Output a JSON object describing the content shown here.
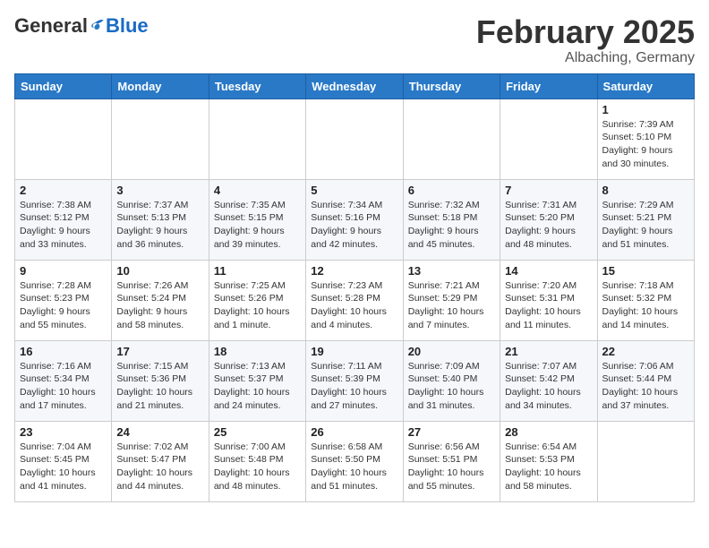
{
  "header": {
    "logo_general": "General",
    "logo_blue": "Blue",
    "month": "February 2025",
    "location": "Albaching, Germany"
  },
  "weekdays": [
    "Sunday",
    "Monday",
    "Tuesday",
    "Wednesday",
    "Thursday",
    "Friday",
    "Saturday"
  ],
  "weeks": [
    [
      {
        "day": "",
        "info": ""
      },
      {
        "day": "",
        "info": ""
      },
      {
        "day": "",
        "info": ""
      },
      {
        "day": "",
        "info": ""
      },
      {
        "day": "",
        "info": ""
      },
      {
        "day": "",
        "info": ""
      },
      {
        "day": "1",
        "info": "Sunrise: 7:39 AM\nSunset: 5:10 PM\nDaylight: 9 hours and 30 minutes."
      }
    ],
    [
      {
        "day": "2",
        "info": "Sunrise: 7:38 AM\nSunset: 5:12 PM\nDaylight: 9 hours and 33 minutes."
      },
      {
        "day": "3",
        "info": "Sunrise: 7:37 AM\nSunset: 5:13 PM\nDaylight: 9 hours and 36 minutes."
      },
      {
        "day": "4",
        "info": "Sunrise: 7:35 AM\nSunset: 5:15 PM\nDaylight: 9 hours and 39 minutes."
      },
      {
        "day": "5",
        "info": "Sunrise: 7:34 AM\nSunset: 5:16 PM\nDaylight: 9 hours and 42 minutes."
      },
      {
        "day": "6",
        "info": "Sunrise: 7:32 AM\nSunset: 5:18 PM\nDaylight: 9 hours and 45 minutes."
      },
      {
        "day": "7",
        "info": "Sunrise: 7:31 AM\nSunset: 5:20 PM\nDaylight: 9 hours and 48 minutes."
      },
      {
        "day": "8",
        "info": "Sunrise: 7:29 AM\nSunset: 5:21 PM\nDaylight: 9 hours and 51 minutes."
      }
    ],
    [
      {
        "day": "9",
        "info": "Sunrise: 7:28 AM\nSunset: 5:23 PM\nDaylight: 9 hours and 55 minutes."
      },
      {
        "day": "10",
        "info": "Sunrise: 7:26 AM\nSunset: 5:24 PM\nDaylight: 9 hours and 58 minutes."
      },
      {
        "day": "11",
        "info": "Sunrise: 7:25 AM\nSunset: 5:26 PM\nDaylight: 10 hours and 1 minute."
      },
      {
        "day": "12",
        "info": "Sunrise: 7:23 AM\nSunset: 5:28 PM\nDaylight: 10 hours and 4 minutes."
      },
      {
        "day": "13",
        "info": "Sunrise: 7:21 AM\nSunset: 5:29 PM\nDaylight: 10 hours and 7 minutes."
      },
      {
        "day": "14",
        "info": "Sunrise: 7:20 AM\nSunset: 5:31 PM\nDaylight: 10 hours and 11 minutes."
      },
      {
        "day": "15",
        "info": "Sunrise: 7:18 AM\nSunset: 5:32 PM\nDaylight: 10 hours and 14 minutes."
      }
    ],
    [
      {
        "day": "16",
        "info": "Sunrise: 7:16 AM\nSunset: 5:34 PM\nDaylight: 10 hours and 17 minutes."
      },
      {
        "day": "17",
        "info": "Sunrise: 7:15 AM\nSunset: 5:36 PM\nDaylight: 10 hours and 21 minutes."
      },
      {
        "day": "18",
        "info": "Sunrise: 7:13 AM\nSunset: 5:37 PM\nDaylight: 10 hours and 24 minutes."
      },
      {
        "day": "19",
        "info": "Sunrise: 7:11 AM\nSunset: 5:39 PM\nDaylight: 10 hours and 27 minutes."
      },
      {
        "day": "20",
        "info": "Sunrise: 7:09 AM\nSunset: 5:40 PM\nDaylight: 10 hours and 31 minutes."
      },
      {
        "day": "21",
        "info": "Sunrise: 7:07 AM\nSunset: 5:42 PM\nDaylight: 10 hours and 34 minutes."
      },
      {
        "day": "22",
        "info": "Sunrise: 7:06 AM\nSunset: 5:44 PM\nDaylight: 10 hours and 37 minutes."
      }
    ],
    [
      {
        "day": "23",
        "info": "Sunrise: 7:04 AM\nSunset: 5:45 PM\nDaylight: 10 hours and 41 minutes."
      },
      {
        "day": "24",
        "info": "Sunrise: 7:02 AM\nSunset: 5:47 PM\nDaylight: 10 hours and 44 minutes."
      },
      {
        "day": "25",
        "info": "Sunrise: 7:00 AM\nSunset: 5:48 PM\nDaylight: 10 hours and 48 minutes."
      },
      {
        "day": "26",
        "info": "Sunrise: 6:58 AM\nSunset: 5:50 PM\nDaylight: 10 hours and 51 minutes."
      },
      {
        "day": "27",
        "info": "Sunrise: 6:56 AM\nSunset: 5:51 PM\nDaylight: 10 hours and 55 minutes."
      },
      {
        "day": "28",
        "info": "Sunrise: 6:54 AM\nSunset: 5:53 PM\nDaylight: 10 hours and 58 minutes."
      },
      {
        "day": "",
        "info": ""
      }
    ]
  ]
}
